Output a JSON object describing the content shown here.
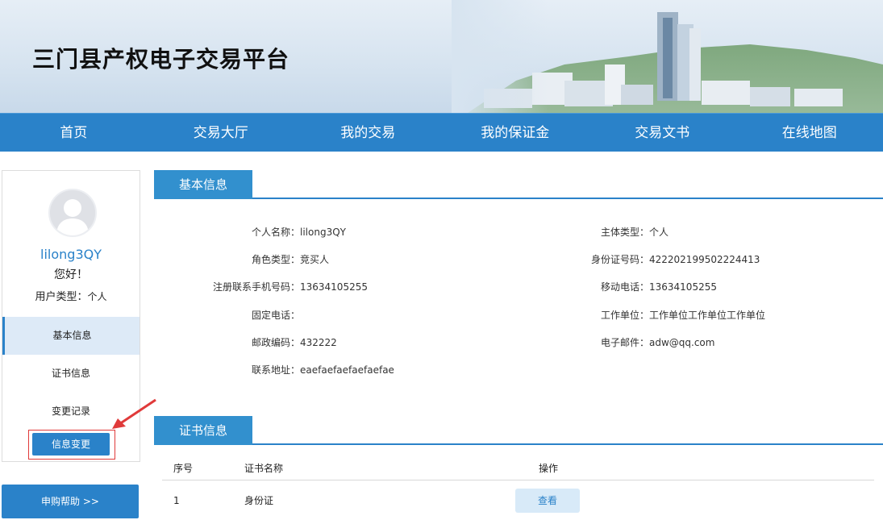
{
  "site": {
    "title": "三门县产权电子交易平台"
  },
  "nav": [
    "首页",
    "交易大厅",
    "我的交易",
    "我的保证金",
    "交易文书",
    "在线地图"
  ],
  "sidebar": {
    "username": "lilong3QY",
    "greeting": "您好！",
    "user_type_label": "用户类型：",
    "user_type_value": "个人",
    "menu": [
      "基本信息",
      "证书信息",
      "变更记录"
    ],
    "change_button": "信息变更",
    "help_button": "申购帮助 >>"
  },
  "basic_info": {
    "section_title": "基本信息",
    "left": [
      {
        "label": "个人名称：",
        "value": "lilong3QY"
      },
      {
        "label": "角色类型：",
        "value": "竞买人"
      },
      {
        "label": "注册联系手机号码：",
        "value": "13634105255"
      },
      {
        "label": "固定电话：",
        "value": ""
      },
      {
        "label": "邮政编码：",
        "value": "432222"
      },
      {
        "label": "联系地址：",
        "value": "eaefaefaefaefaefae"
      }
    ],
    "right": [
      {
        "label": "主体类型：",
        "value": "个人"
      },
      {
        "label": "身份证号码：",
        "value": "422202199502224413"
      },
      {
        "label": "移动电话：",
        "value": "13634105255"
      },
      {
        "label": "工作单位：",
        "value": "工作单位工作单位工作单位"
      },
      {
        "label": "电子邮件：",
        "value": "adw@qq.com"
      }
    ]
  },
  "certificates": {
    "section_title": "证书信息",
    "headers": [
      "序号",
      "证书名称",
      "操作"
    ],
    "rows": [
      {
        "index": "1",
        "name": "身份证",
        "action": "查看"
      }
    ]
  },
  "colors": {
    "primary": "#2a82c9",
    "active_bg": "#ddeaf7",
    "highlight": "#e03a3a"
  }
}
